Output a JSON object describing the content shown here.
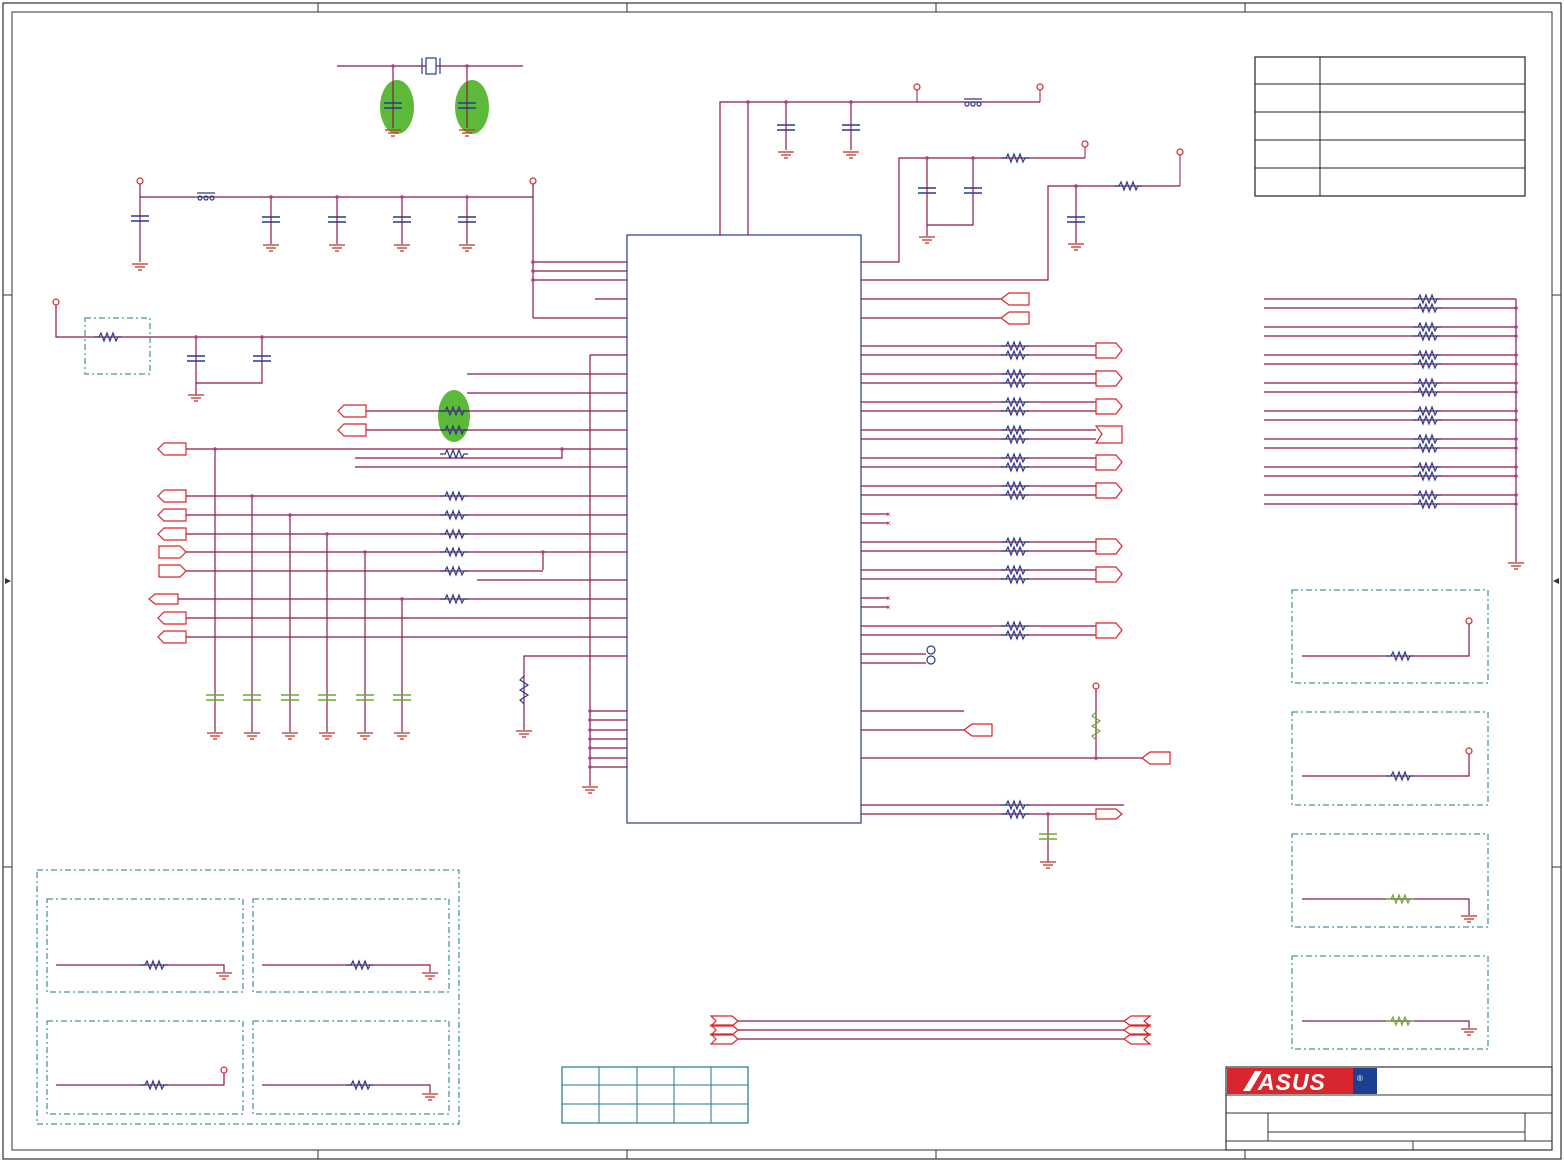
{
  "colors": {
    "wire": "#8b1a4a",
    "symbol": "#2a3a8c",
    "pin": "#d9262b",
    "ground": "#c0392b",
    "zone": "#1f7a85",
    "highlight": "#5cb93a",
    "border": "#333333",
    "brand_red": "#d8262e",
    "brand_blue": "#1d3f8f"
  },
  "logo": {
    "text": "ASUS"
  },
  "title_block": {
    "rows": [
      {
        "label": "",
        "value": ""
      },
      {
        "label": "",
        "value": ""
      },
      {
        "label": "",
        "value": ""
      },
      {
        "label": "",
        "value": ""
      },
      {
        "label": "",
        "value": ""
      }
    ]
  },
  "icons": {
    "ground": "ground-symbol-icon",
    "resistor": "resistor-icon",
    "capacitor": "capacitor-icon",
    "crystal": "crystal-icon",
    "connector": "connector-arrow-icon"
  }
}
